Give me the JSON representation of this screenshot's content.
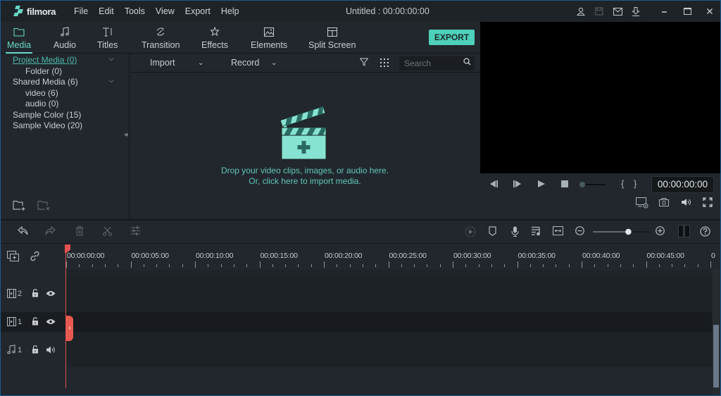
{
  "app": {
    "name": "filmora",
    "menu": [
      "File",
      "Edit",
      "Tools",
      "View",
      "Export",
      "Help"
    ],
    "title": "Untitled : 00:00:00:00",
    "title_icons": [
      "account-icon",
      "save-icon",
      "mail-icon",
      "download-icon"
    ],
    "window_controls": [
      "minimize-icon",
      "maximize-icon",
      "close-icon"
    ]
  },
  "tabs": [
    {
      "label": "Media",
      "icon": "folder-icon",
      "active": true
    },
    {
      "label": "Audio",
      "icon": "music-note-icon",
      "active": false
    },
    {
      "label": "Titles",
      "icon": "text-icon",
      "active": false
    },
    {
      "label": "Transition",
      "icon": "transition-icon",
      "active": false
    },
    {
      "label": "Effects",
      "icon": "effects-icon",
      "active": false
    },
    {
      "label": "Elements",
      "icon": "image-icon",
      "active": false
    },
    {
      "label": "Split Screen",
      "icon": "split-screen-icon",
      "active": false
    }
  ],
  "export_label": "EXPORT",
  "library": {
    "items": [
      {
        "label": "Project Media (0)",
        "level": 0,
        "expandable": true,
        "selected": true
      },
      {
        "label": "Folder (0)",
        "level": 1
      },
      {
        "label": "Shared Media (6)",
        "level": 0,
        "expandable": true
      },
      {
        "label": "video (6)",
        "level": 1
      },
      {
        "label": "audio (0)",
        "level": 1
      },
      {
        "label": "Sample Color (15)",
        "level": 0
      },
      {
        "label": "Sample Video (20)",
        "level": 0
      }
    ]
  },
  "media_toolbar": {
    "import_label": "Import",
    "record_label": "Record",
    "search_placeholder": "Search"
  },
  "drop_zone": {
    "line1": "Drop your video clips, images, or audio here.",
    "line2": "Or, click here to import media."
  },
  "preview": {
    "timecode": "00:00:00:00",
    "mark_in": "{",
    "mark_out": "}"
  },
  "timeline": {
    "ruler_labels": [
      "00:00:00:00",
      "00:00:05:00",
      "00:00:10:00",
      "00:00:15:00",
      "00:00:20:00",
      "00:00:25:00",
      "00:00:30:00",
      "00:00:35:00",
      "00:00:40:00",
      "00:00:45:00"
    ],
    "zoom_level": 0.65,
    "tracks": [
      {
        "type": "video",
        "number": "2"
      },
      {
        "type": "video",
        "number": "1"
      },
      {
        "type": "audio",
        "number": "1"
      }
    ]
  },
  "colors": {
    "accent": "#67d8c6",
    "export_bg": "#4fd0ba",
    "playhead": "#e2524f"
  }
}
